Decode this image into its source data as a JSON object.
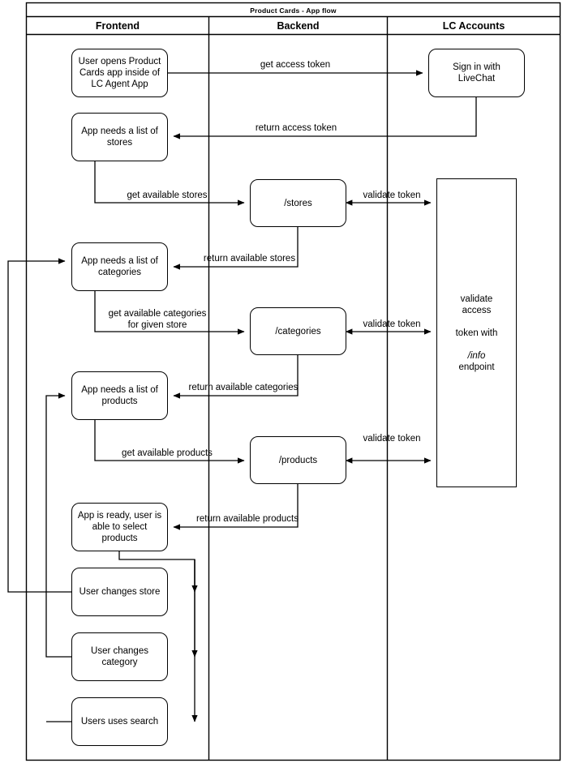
{
  "diagram": {
    "title": "Product Cards - App flow",
    "type": "swimlane-flowchart",
    "lanes": [
      {
        "id": "frontend",
        "label": "Frontend"
      },
      {
        "id": "backend",
        "label": "Backend"
      },
      {
        "id": "lc-accounts",
        "label": "LC Accounts"
      }
    ],
    "nodes": [
      {
        "id": "n1",
        "lane": "frontend",
        "shape": "rounded",
        "text": "User opens Product Cards app inside of LC Agent App"
      },
      {
        "id": "n2",
        "lane": "frontend",
        "shape": "rounded",
        "text": "App needs a list of stores"
      },
      {
        "id": "n3",
        "lane": "frontend",
        "shape": "rounded",
        "text": "App needs a list of categories"
      },
      {
        "id": "n4",
        "lane": "frontend",
        "shape": "rounded",
        "text": "App needs a list of products"
      },
      {
        "id": "n5",
        "lane": "frontend",
        "shape": "rounded",
        "text": "App is ready, user is able to select products"
      },
      {
        "id": "n6",
        "lane": "frontend",
        "shape": "rounded",
        "text": "User changes store"
      },
      {
        "id": "n7",
        "lane": "frontend",
        "shape": "rounded",
        "text": "User changes category"
      },
      {
        "id": "n8",
        "lane": "frontend",
        "shape": "rounded",
        "text": "Users uses search"
      },
      {
        "id": "n9",
        "lane": "backend",
        "shape": "rounded",
        "text": "/stores"
      },
      {
        "id": "n10",
        "lane": "backend",
        "shape": "rounded",
        "text": "/categories"
      },
      {
        "id": "n11",
        "lane": "backend",
        "shape": "rounded",
        "text": "/products"
      },
      {
        "id": "n12",
        "lane": "lc-accounts",
        "shape": "rounded",
        "text": "Sign in with LiveChat"
      },
      {
        "id": "n13",
        "lane": "lc-accounts",
        "shape": "rect",
        "text_line1": "validate access",
        "text_line2": "token with",
        "text_line3_italic": "/info",
        "text_line3_rest": " endpoint"
      }
    ],
    "edges": [
      {
        "id": "e1",
        "from": "n1",
        "to": "n12",
        "label": "get access token"
      },
      {
        "id": "e2",
        "from": "n12",
        "to": "n2",
        "label": "return access token"
      },
      {
        "id": "e3",
        "from": "n2",
        "to": "n9",
        "label": "get available stores"
      },
      {
        "id": "e4",
        "from": "n9",
        "to": "n3",
        "label": "return available stores"
      },
      {
        "id": "e5",
        "from": "n9",
        "to": "n13",
        "label": "validate token",
        "bidirectional": true
      },
      {
        "id": "e6",
        "from": "n3",
        "to": "n10",
        "label_line1": "get available categories",
        "label_line2": "for given store"
      },
      {
        "id": "e7",
        "from": "n10",
        "to": "n4",
        "label": "return available categories"
      },
      {
        "id": "e8",
        "from": "n10",
        "to": "n13",
        "label": "validate token",
        "bidirectional": true
      },
      {
        "id": "e9",
        "from": "n4",
        "to": "n11",
        "label": "get available products"
      },
      {
        "id": "e10",
        "from": "n11",
        "to": "n5",
        "label": "return available products"
      },
      {
        "id": "e11",
        "from": "n11",
        "to": "n13",
        "label": "validate token",
        "bidirectional": true
      },
      {
        "id": "e12",
        "from": "n5",
        "to": "n6",
        "label": ""
      },
      {
        "id": "e13",
        "from": "n5",
        "to": "n7",
        "label": ""
      },
      {
        "id": "e14",
        "from": "n5",
        "to": "n8",
        "label": ""
      },
      {
        "id": "e15",
        "from": "n6",
        "to": "n3",
        "label": ""
      },
      {
        "id": "e16",
        "from": "n7",
        "to": "n4",
        "label": ""
      },
      {
        "id": "e17",
        "from": "n8",
        "to": "n4",
        "label": ""
      }
    ],
    "colors": {
      "stroke": "#000000",
      "fill": "#ffffff",
      "text": "#000000"
    }
  }
}
